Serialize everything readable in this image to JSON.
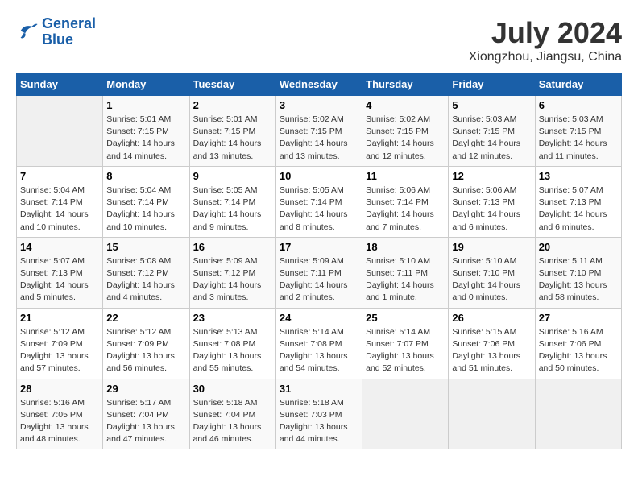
{
  "header": {
    "logo_line1": "General",
    "logo_line2": "Blue",
    "title": "July 2024",
    "subtitle": "Xiongzhou, Jiangsu, China"
  },
  "columns": [
    "Sunday",
    "Monday",
    "Tuesday",
    "Wednesday",
    "Thursday",
    "Friday",
    "Saturday"
  ],
  "weeks": [
    [
      {
        "day": "",
        "empty": true
      },
      {
        "day": "1",
        "sunrise": "5:01 AM",
        "sunset": "7:15 PM",
        "daylight": "14 hours and 14 minutes."
      },
      {
        "day": "2",
        "sunrise": "5:01 AM",
        "sunset": "7:15 PM",
        "daylight": "14 hours and 13 minutes."
      },
      {
        "day": "3",
        "sunrise": "5:02 AM",
        "sunset": "7:15 PM",
        "daylight": "14 hours and 13 minutes."
      },
      {
        "day": "4",
        "sunrise": "5:02 AM",
        "sunset": "7:15 PM",
        "daylight": "14 hours and 12 minutes."
      },
      {
        "day": "5",
        "sunrise": "5:03 AM",
        "sunset": "7:15 PM",
        "daylight": "14 hours and 12 minutes."
      },
      {
        "day": "6",
        "sunrise": "5:03 AM",
        "sunset": "7:15 PM",
        "daylight": "14 hours and 11 minutes."
      }
    ],
    [
      {
        "day": "7",
        "sunrise": "5:04 AM",
        "sunset": "7:14 PM",
        "daylight": "14 hours and 10 minutes."
      },
      {
        "day": "8",
        "sunrise": "5:04 AM",
        "sunset": "7:14 PM",
        "daylight": "14 hours and 10 minutes."
      },
      {
        "day": "9",
        "sunrise": "5:05 AM",
        "sunset": "7:14 PM",
        "daylight": "14 hours and 9 minutes."
      },
      {
        "day": "10",
        "sunrise": "5:05 AM",
        "sunset": "7:14 PM",
        "daylight": "14 hours and 8 minutes."
      },
      {
        "day": "11",
        "sunrise": "5:06 AM",
        "sunset": "7:14 PM",
        "daylight": "14 hours and 7 minutes."
      },
      {
        "day": "12",
        "sunrise": "5:06 AM",
        "sunset": "7:13 PM",
        "daylight": "14 hours and 6 minutes."
      },
      {
        "day": "13",
        "sunrise": "5:07 AM",
        "sunset": "7:13 PM",
        "daylight": "14 hours and 6 minutes."
      }
    ],
    [
      {
        "day": "14",
        "sunrise": "5:07 AM",
        "sunset": "7:13 PM",
        "daylight": "14 hours and 5 minutes."
      },
      {
        "day": "15",
        "sunrise": "5:08 AM",
        "sunset": "7:12 PM",
        "daylight": "14 hours and 4 minutes."
      },
      {
        "day": "16",
        "sunrise": "5:09 AM",
        "sunset": "7:12 PM",
        "daylight": "14 hours and 3 minutes."
      },
      {
        "day": "17",
        "sunrise": "5:09 AM",
        "sunset": "7:11 PM",
        "daylight": "14 hours and 2 minutes."
      },
      {
        "day": "18",
        "sunrise": "5:10 AM",
        "sunset": "7:11 PM",
        "daylight": "14 hours and 1 minute."
      },
      {
        "day": "19",
        "sunrise": "5:10 AM",
        "sunset": "7:10 PM",
        "daylight": "14 hours and 0 minutes."
      },
      {
        "day": "20",
        "sunrise": "5:11 AM",
        "sunset": "7:10 PM",
        "daylight": "13 hours and 58 minutes."
      }
    ],
    [
      {
        "day": "21",
        "sunrise": "5:12 AM",
        "sunset": "7:09 PM",
        "daylight": "13 hours and 57 minutes."
      },
      {
        "day": "22",
        "sunrise": "5:12 AM",
        "sunset": "7:09 PM",
        "daylight": "13 hours and 56 minutes."
      },
      {
        "day": "23",
        "sunrise": "5:13 AM",
        "sunset": "7:08 PM",
        "daylight": "13 hours and 55 minutes."
      },
      {
        "day": "24",
        "sunrise": "5:14 AM",
        "sunset": "7:08 PM",
        "daylight": "13 hours and 54 minutes."
      },
      {
        "day": "25",
        "sunrise": "5:14 AM",
        "sunset": "7:07 PM",
        "daylight": "13 hours and 52 minutes."
      },
      {
        "day": "26",
        "sunrise": "5:15 AM",
        "sunset": "7:06 PM",
        "daylight": "13 hours and 51 minutes."
      },
      {
        "day": "27",
        "sunrise": "5:16 AM",
        "sunset": "7:06 PM",
        "daylight": "13 hours and 50 minutes."
      }
    ],
    [
      {
        "day": "28",
        "sunrise": "5:16 AM",
        "sunset": "7:05 PM",
        "daylight": "13 hours and 48 minutes."
      },
      {
        "day": "29",
        "sunrise": "5:17 AM",
        "sunset": "7:04 PM",
        "daylight": "13 hours and 47 minutes."
      },
      {
        "day": "30",
        "sunrise": "5:18 AM",
        "sunset": "7:04 PM",
        "daylight": "13 hours and 46 minutes."
      },
      {
        "day": "31",
        "sunrise": "5:18 AM",
        "sunset": "7:03 PM",
        "daylight": "13 hours and 44 minutes."
      },
      {
        "day": "",
        "empty": true
      },
      {
        "day": "",
        "empty": true
      },
      {
        "day": "",
        "empty": true
      }
    ]
  ]
}
